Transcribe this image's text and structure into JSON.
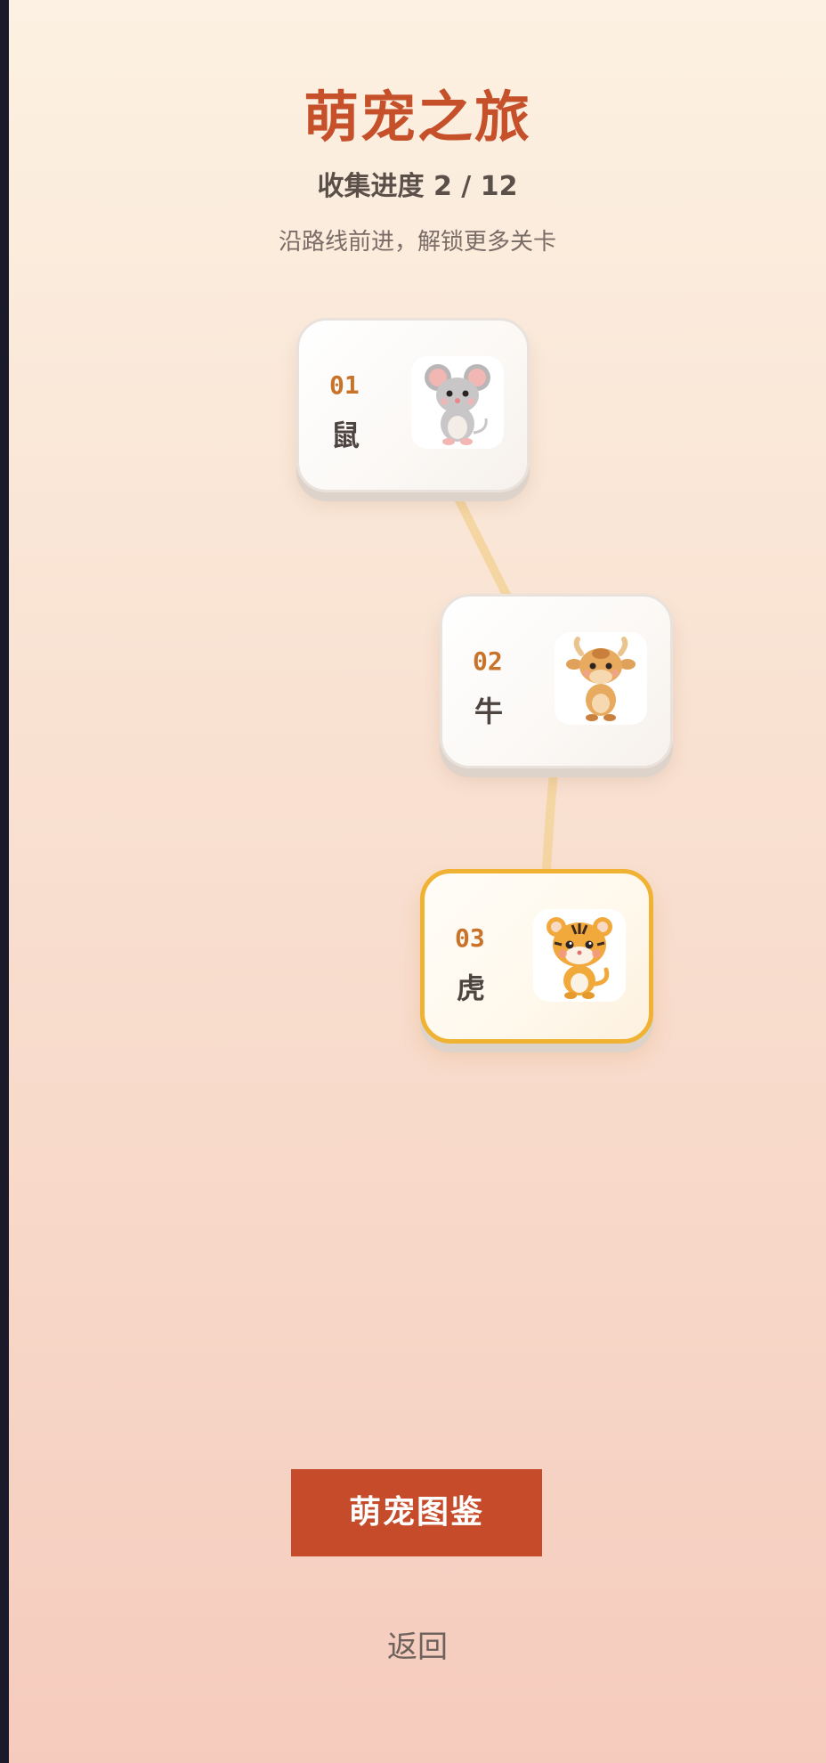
{
  "header": {
    "title": "萌宠之旅",
    "progress": "收集进度 2 / 12",
    "subtitle": "沿路线前进，解锁更多关卡"
  },
  "levels": [
    {
      "number": "01",
      "name": "鼠",
      "icon": "mouse-pet-icon",
      "state": "unlocked"
    },
    {
      "number": "02",
      "name": "牛",
      "icon": "ox-pet-icon",
      "state": "unlocked"
    },
    {
      "number": "03",
      "name": "虎",
      "icon": "tiger-pet-icon",
      "state": "current"
    }
  ],
  "actions": {
    "gallery_label": "萌宠图鉴",
    "back_label": "返回"
  },
  "colors": {
    "title": "#c5502a",
    "button": "#c64b2a",
    "current_border": "#f0b232",
    "level_number": "#c8722a",
    "path": "#f3d39a"
  }
}
